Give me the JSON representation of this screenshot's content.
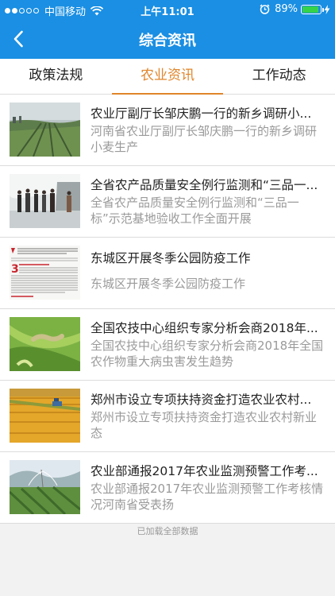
{
  "status_bar": {
    "carrier": "中国移动",
    "time": "上午11:01",
    "battery": "89%",
    "battery_level": 0.89
  },
  "header": {
    "title": "综合资讯",
    "back_icon": "chevron-left-icon"
  },
  "tabs": [
    {
      "label": "政策法规",
      "active": false
    },
    {
      "label": "农业资讯",
      "active": true
    },
    {
      "label": "工作动态",
      "active": false
    }
  ],
  "news": [
    {
      "title": "农业厅副厅长邹庆鹏一行的新乡调研小...",
      "summary": "河南省农业厅副厅长邹庆鹏一行的新乡调研小麦生产",
      "image": "wheat-field-photo"
    },
    {
      "title": "全省农产品质量安全例行监测和“三品一...",
      "summary": "全省农产品质量安全例行监测和“三品一标”示范基地验收工作全面开展",
      "image": "inspection-group-photo"
    },
    {
      "title": "东城区开展冬季公园防疫工作",
      "summary": "东城区开展冬季公园防疫工作",
      "image": "newspaper-clipping"
    },
    {
      "title": "全国农技中心组织专家分析会商2018年...",
      "summary": "全国农技中心组织专家分析会商2018年全国农作物重大病虫害发生趋势",
      "image": "corn-pest-photo"
    },
    {
      "title": "郑州市设立专项扶持资金打造农业农村...",
      "summary": "郑州市设立专项扶持资金打造农业农村新业态",
      "image": "harvest-field-photo"
    },
    {
      "title": "农业部通报2017年农业监测预警工作考...",
      "summary": "农业部通报2017年农业监测预警工作考核情况河南省受表扬",
      "image": "irrigation-field-photo"
    }
  ],
  "footer": {
    "load_status": "已加载全部数据"
  }
}
